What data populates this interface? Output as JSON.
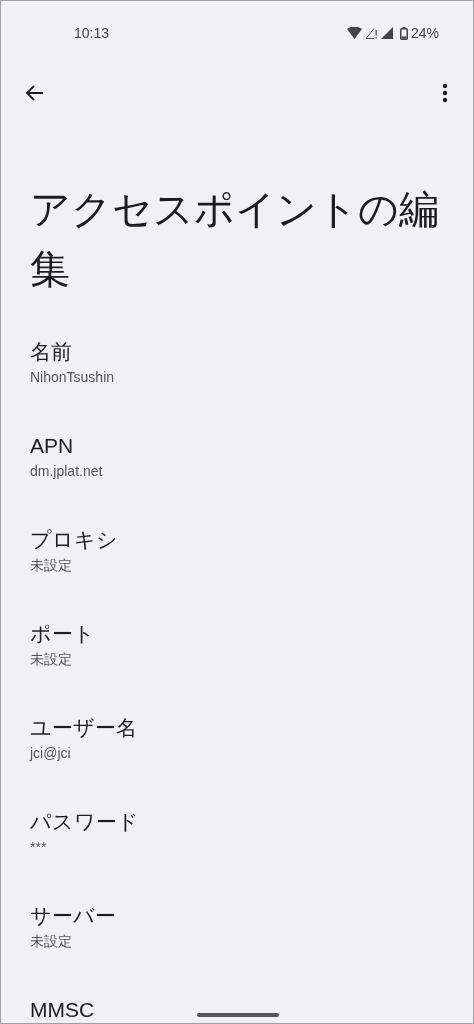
{
  "status_bar": {
    "time": "10:13",
    "battery": "24%"
  },
  "title": "アクセスポイントの編集",
  "fields": [
    {
      "label": "名前",
      "value": "NihonTsushin"
    },
    {
      "label": "APN",
      "value": "dm.jplat.net"
    },
    {
      "label": "プロキシ",
      "value": "未設定"
    },
    {
      "label": "ポート",
      "value": "未設定"
    },
    {
      "label": "ユーザー名",
      "value": "jci@jci"
    },
    {
      "label": "パスワード",
      "value": "***"
    },
    {
      "label": "サーバー",
      "value": "未設定"
    },
    {
      "label": "MMSC"
    }
  ]
}
